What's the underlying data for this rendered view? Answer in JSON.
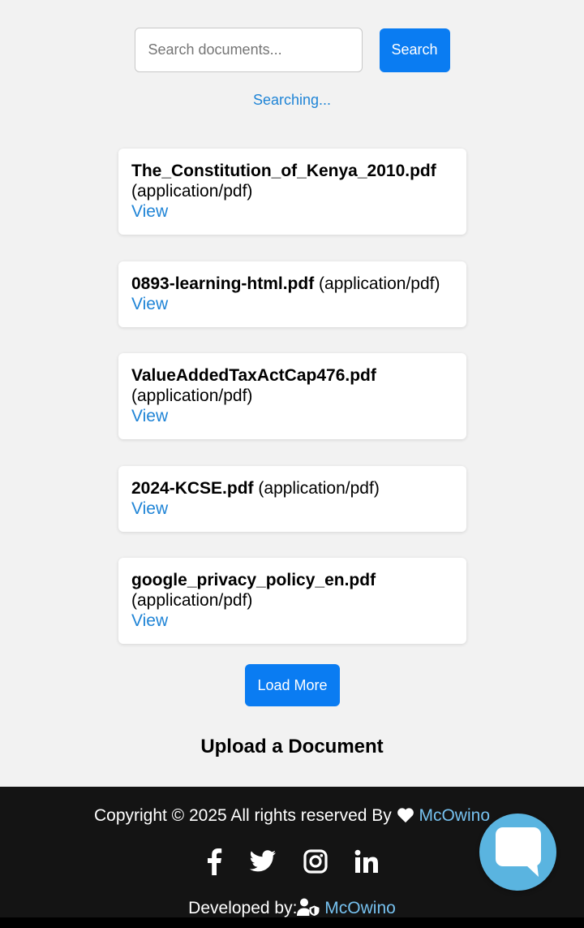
{
  "search": {
    "placeholder": "Search documents...",
    "button_label": "Search",
    "status": "Searching..."
  },
  "documents": [
    {
      "name": "The_Constitution_of_Kenya_2010.pdf",
      "type": "(application/pdf)",
      "view_label": "View"
    },
    {
      "name": "0893-learning-html.pdf",
      "type": "(application/pdf)",
      "view_label": "View"
    },
    {
      "name": "ValueAddedTaxActCap476.pdf",
      "type": "(application/pdf)",
      "view_label": "View"
    },
    {
      "name": "2024-KCSE.pdf",
      "type": "(application/pdf)",
      "view_label": "View"
    },
    {
      "name": "google_privacy_policy_en.pdf",
      "type": "(application/pdf)",
      "view_label": "View"
    }
  ],
  "load_more_label": "Load More",
  "upload_heading": "Upload a Document",
  "footer": {
    "copyright_text": "Copyright © 2025 All rights reserved By",
    "copyright_link": "McOwino",
    "social_icons": [
      "facebook-icon",
      "twitter-icon",
      "instagram-icon",
      "linkedin-icon"
    ],
    "developed_text": "Developed by:",
    "developed_link": "McOwino"
  },
  "colors": {
    "primary": "#0a7cf2",
    "link": "#1f84d6",
    "footer_bg": "#141414",
    "footer_link": "#76c1ef",
    "chat_button": "#5ab4e0"
  }
}
